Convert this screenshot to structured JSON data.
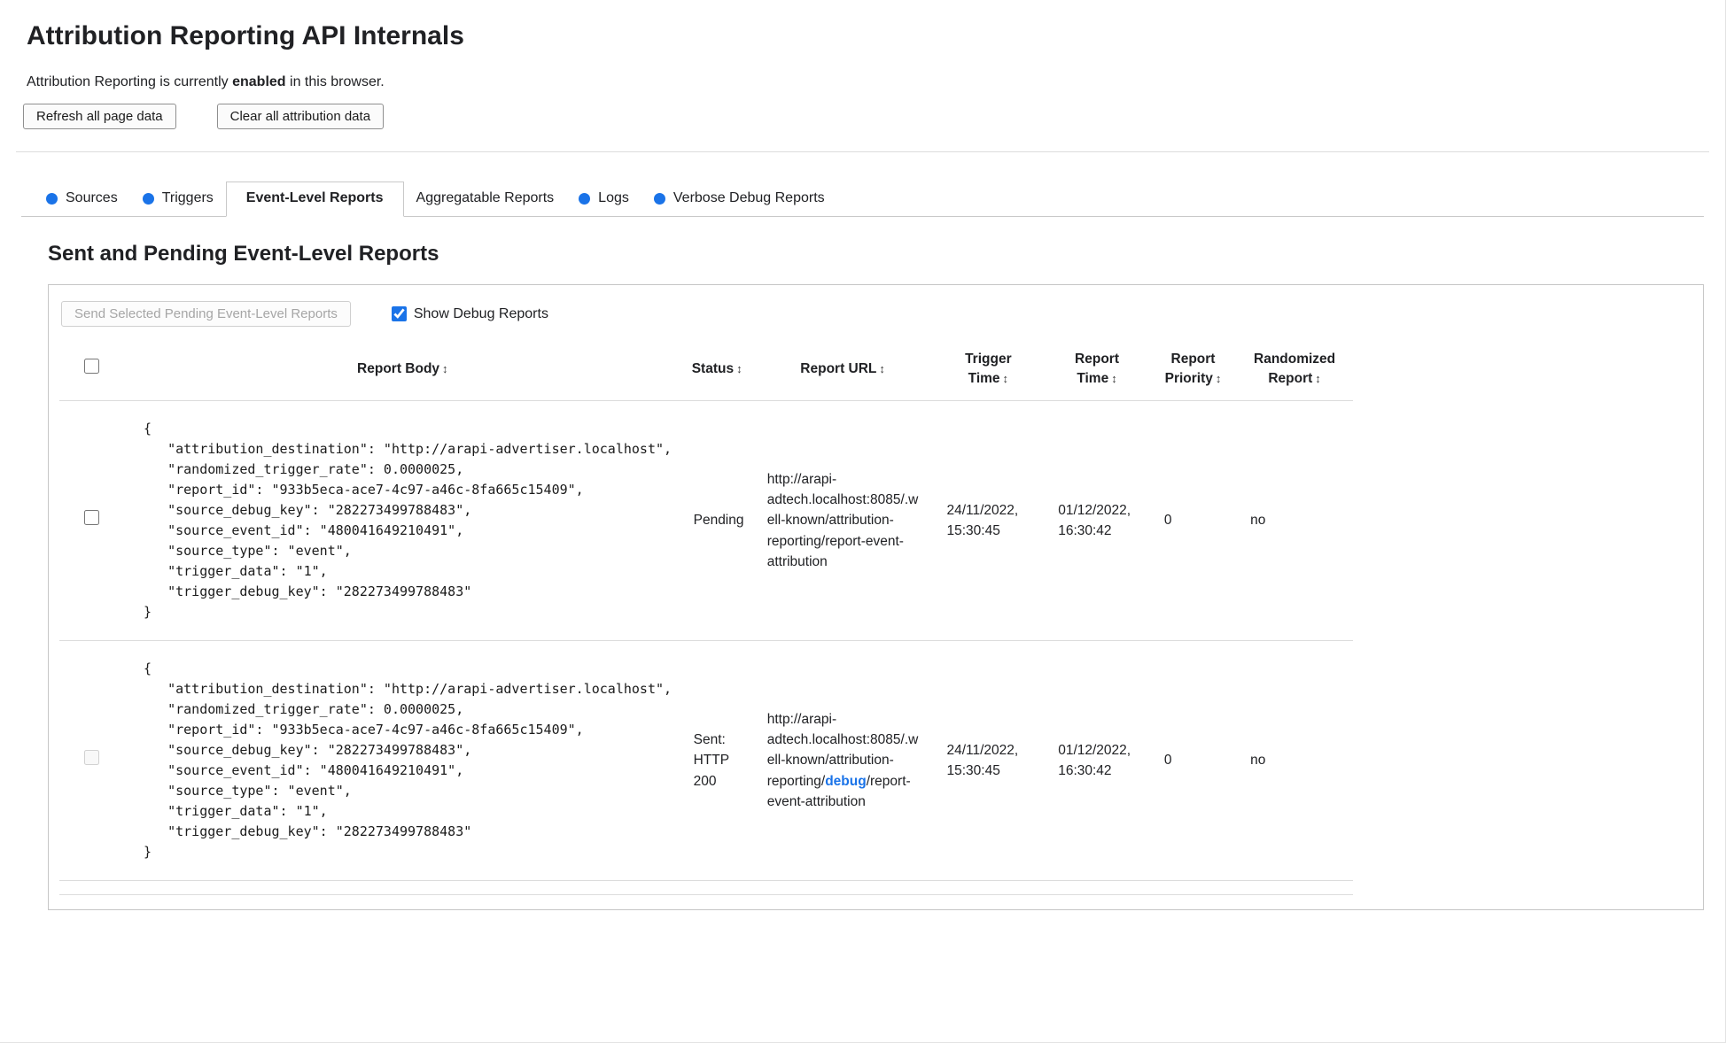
{
  "colors": {
    "accent_blue": "#1a73e8",
    "border_grey": "#c9c9c9"
  },
  "page": {
    "title": "Attribution Reporting API Internals",
    "status_prefix": "Attribution Reporting is currently ",
    "status_bold": "enabled",
    "status_suffix": " in this browser.",
    "refresh_button": "Refresh all page data",
    "clear_button": "Clear all attribution data"
  },
  "tabs": [
    {
      "label": "Sources",
      "has_dot": true,
      "active": false
    },
    {
      "label": "Triggers",
      "has_dot": true,
      "active": false
    },
    {
      "label": "Event-Level Reports",
      "has_dot": false,
      "active": true
    },
    {
      "label": "Aggregatable Reports",
      "has_dot": false,
      "active": false
    },
    {
      "label": "Logs",
      "has_dot": true,
      "active": false
    },
    {
      "label": "Verbose Debug Reports",
      "has_dot": true,
      "active": false
    }
  ],
  "section": {
    "heading": "Sent and Pending Event-Level Reports",
    "send_button": "Send Selected Pending Event-Level Reports",
    "send_button_disabled": true,
    "show_debug_label": "Show Debug Reports",
    "show_debug_checked": true
  },
  "table": {
    "sort_icon": "↕",
    "headers": {
      "report_body": {
        "lines": [
          "Report Body"
        ]
      },
      "status": {
        "lines": [
          "Status"
        ]
      },
      "report_url": {
        "lines": [
          "Report URL"
        ]
      },
      "trigger_time": {
        "lines": [
          "Trigger",
          "Time"
        ]
      },
      "report_time": {
        "lines": [
          "Report",
          "Time"
        ]
      },
      "report_priority": {
        "lines": [
          "Report",
          "Priority"
        ]
      },
      "randomized_report": {
        "lines": [
          "Randomized",
          "Report"
        ]
      }
    },
    "rows": [
      {
        "selected": false,
        "checkbox_disabled": false,
        "body": "{\n   \"attribution_destination\": \"http://arapi-advertiser.localhost\",\n   \"randomized_trigger_rate\": 0.0000025,\n   \"report_id\": \"933b5eca-ace7-4c97-a46c-8fa665c15409\",\n   \"source_debug_key\": \"282273499788483\",\n   \"source_event_id\": \"480041649210491\",\n   \"source_type\": \"event\",\n   \"trigger_data\": \"1\",\n   \"trigger_debug_key\": \"282273499788483\"\n}",
        "status": "Pending",
        "url_prefix": "http://arapi-adtech.localhost:8085/.well-known/attribution-reporting/report-event-attribution",
        "url_debug": "",
        "url_suffix": "",
        "trigger_time": "24/11/2022, 15:30:45",
        "report_time": "01/12/2022, 16:30:42",
        "report_priority": "0",
        "randomized_report": "no"
      },
      {
        "selected": false,
        "checkbox_disabled": true,
        "body": "{\n   \"attribution_destination\": \"http://arapi-advertiser.localhost\",\n   \"randomized_trigger_rate\": 0.0000025,\n   \"report_id\": \"933b5eca-ace7-4c97-a46c-8fa665c15409\",\n   \"source_debug_key\": \"282273499788483\",\n   \"source_event_id\": \"480041649210491\",\n   \"source_type\": \"event\",\n   \"trigger_data\": \"1\",\n   \"trigger_debug_key\": \"282273499788483\"\n}",
        "status": "Sent: HTTP 200",
        "url_prefix": "http://arapi-adtech.localhost:8085/.well-known/attribution-reporting/",
        "url_debug": "debug",
        "url_suffix": "/report-event-attribution",
        "trigger_time": "24/11/2022, 15:30:45",
        "report_time": "01/12/2022, 16:30:42",
        "report_priority": "0",
        "randomized_report": "no"
      }
    ]
  }
}
